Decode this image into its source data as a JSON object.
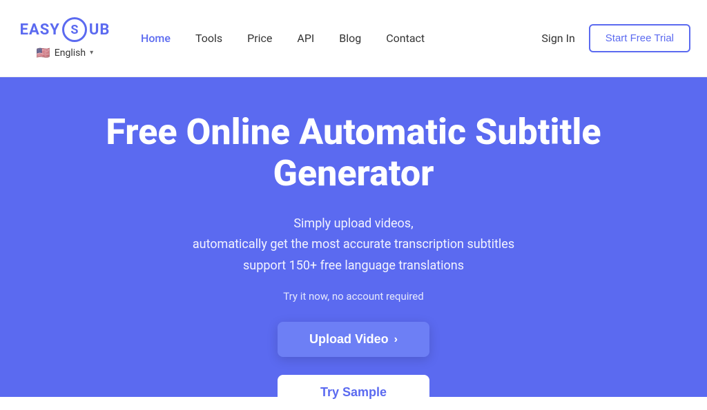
{
  "navbar": {
    "logo": {
      "easy": "EASY",
      "sub_letter": "S",
      "ub": "UB"
    },
    "lang": {
      "flag": "🇺🇸",
      "label": "English",
      "chevron": "▾"
    },
    "links": [
      {
        "label": "Home",
        "active": true
      },
      {
        "label": "Tools",
        "active": false
      },
      {
        "label": "Price",
        "active": false
      },
      {
        "label": "API",
        "active": false
      },
      {
        "label": "Blog",
        "active": false
      },
      {
        "label": "Contact",
        "active": false
      }
    ],
    "sign_in_label": "Sign In",
    "start_trial_label": "Start Free Trial"
  },
  "hero": {
    "title": "Free Online Automatic Subtitle Generator",
    "subtitle_line1": "Simply upload videos,",
    "subtitle_line2": "automatically get the most accurate transcription subtitles",
    "subtitle_line3": "support 150+ free language translations",
    "note": "Try it now, no account required",
    "upload_btn_label": "Upload Video",
    "upload_btn_icon": "›",
    "try_sample_label": "Try Sample"
  }
}
